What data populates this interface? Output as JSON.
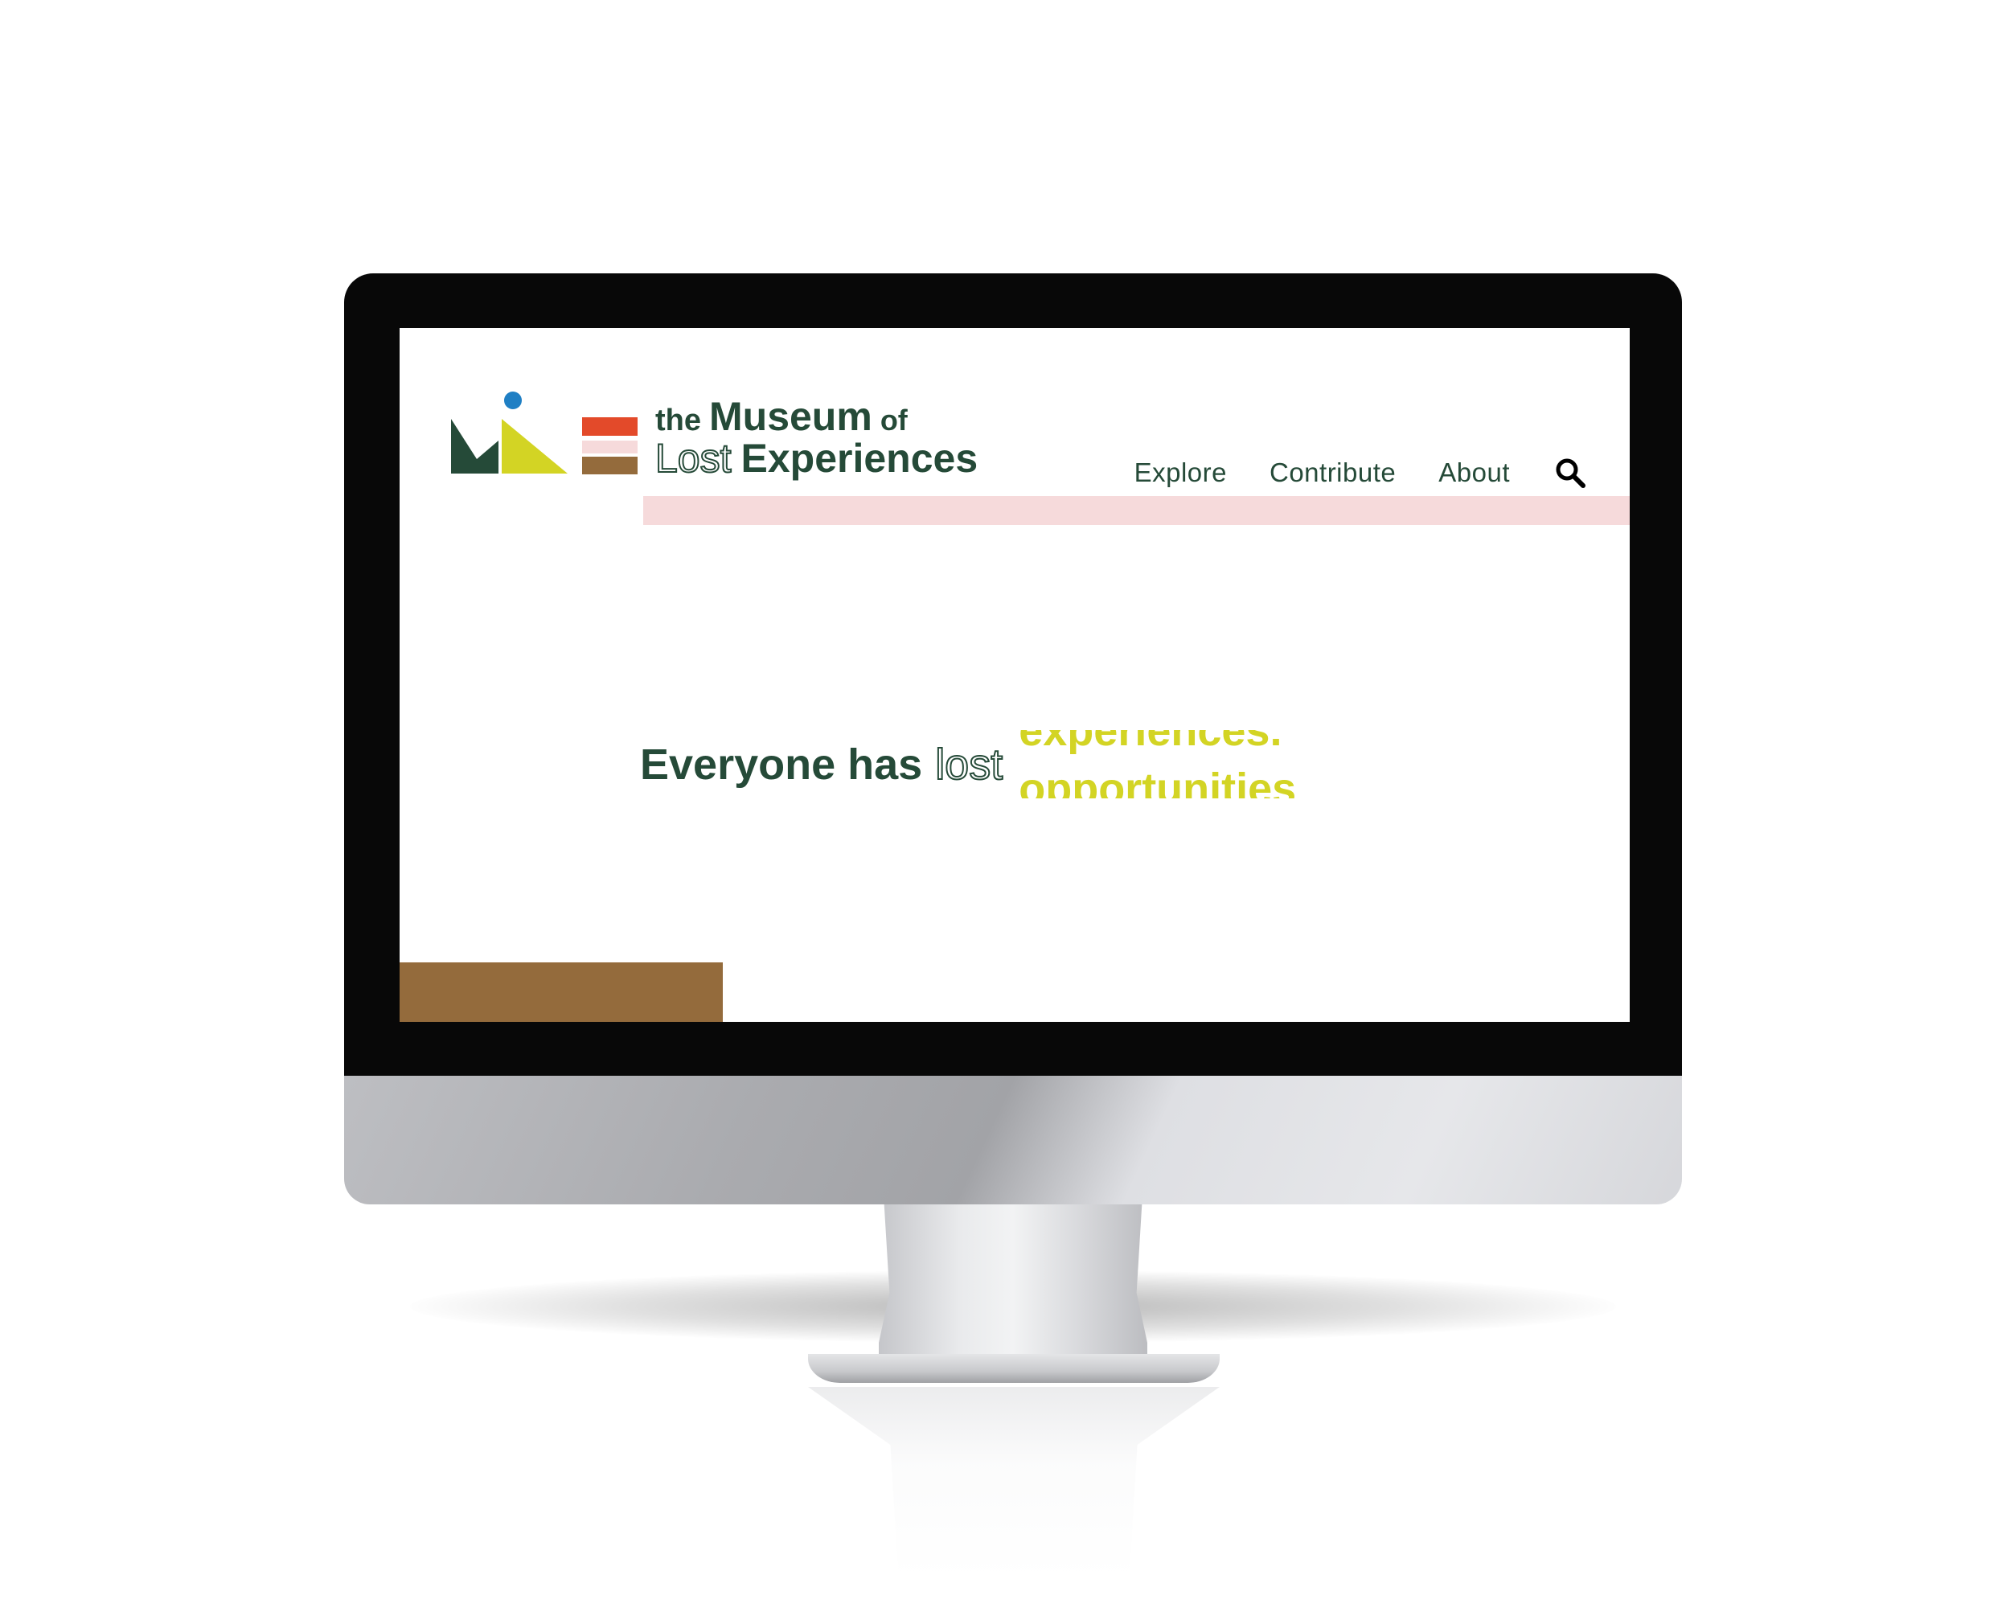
{
  "site": {
    "logo_text": {
      "the": "the",
      "museum": "Museum",
      "of": "of",
      "lost": "Lost",
      "experiences": "Experiences"
    }
  },
  "nav": {
    "items": [
      {
        "label": "Explore"
      },
      {
        "label": "Contribute"
      },
      {
        "label": "About"
      }
    ],
    "search_icon": "search-icon"
  },
  "hero": {
    "headline_prefix": "Everyone has",
    "headline_lost": "lost",
    "rotating_words": [
      "experiences.",
      "opportunities"
    ]
  },
  "colors": {
    "brand_green": "#254a38",
    "accent_yellow": "#d3d424",
    "accent_red": "#e34a2a",
    "accent_pink": "#f6dadb",
    "accent_brown": "#946b3c",
    "accent_blue": "#1f7fc4"
  }
}
